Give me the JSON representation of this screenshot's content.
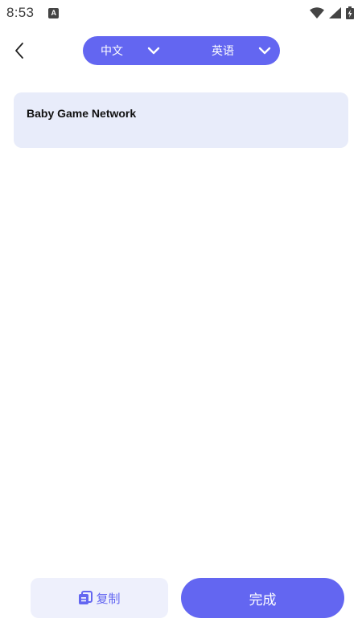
{
  "status_bar": {
    "time": "8:53"
  },
  "language_bar": {
    "source_language": "中文",
    "target_language": "英语"
  },
  "result": {
    "text": "Baby Game Network"
  },
  "actions": {
    "copy_label": "复制",
    "done_label": "完成"
  },
  "colors": {
    "accent": "#6366f1",
    "card_background": "#e8ecfa",
    "copy_button_background": "#eef0fc"
  }
}
